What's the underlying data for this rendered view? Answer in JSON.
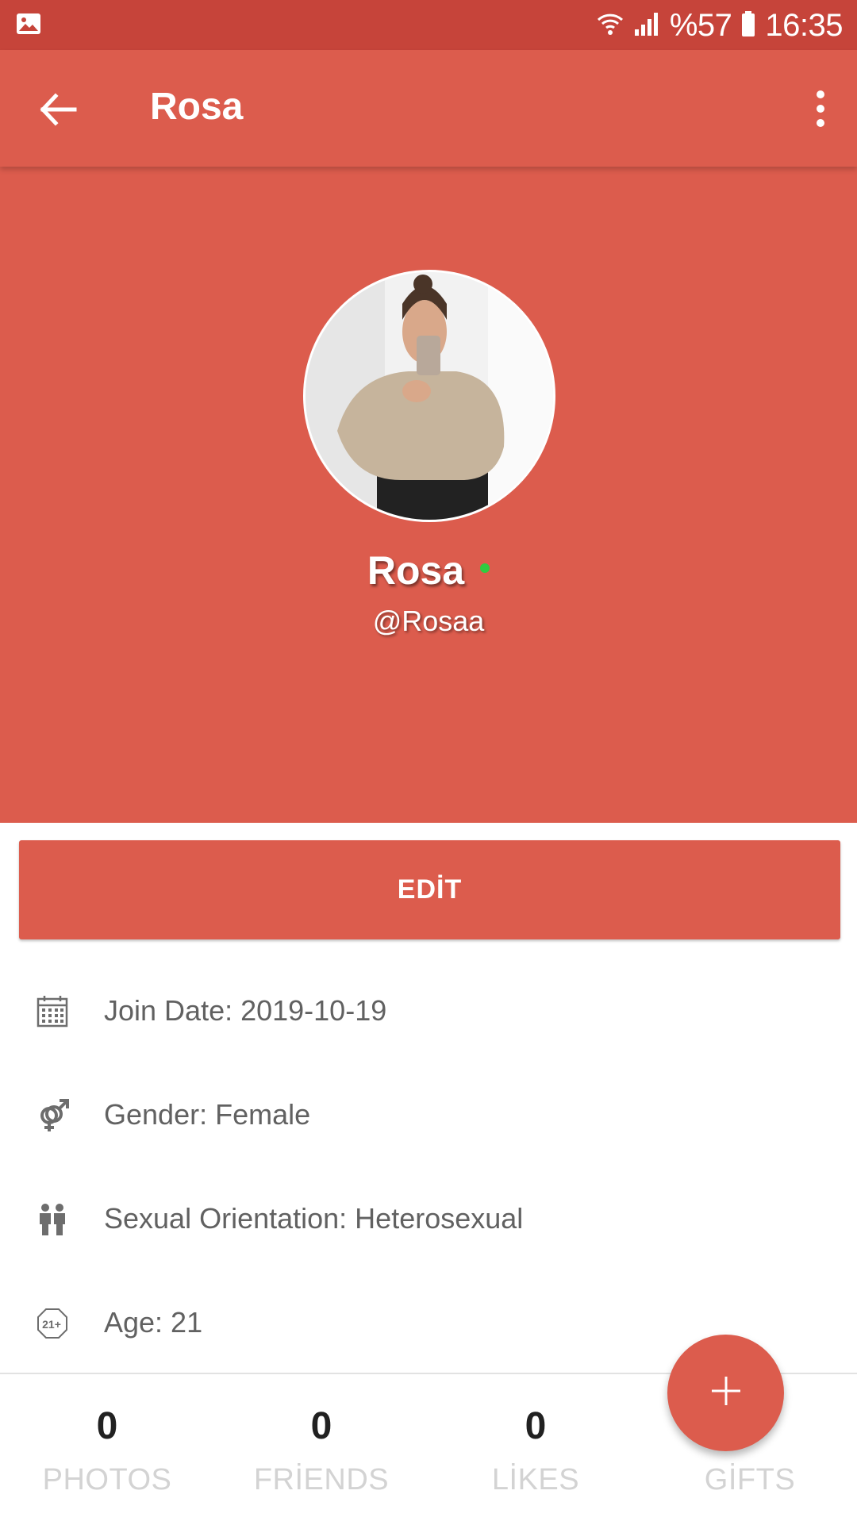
{
  "status_bar": {
    "battery": "%57",
    "time": "16:35",
    "icons": [
      "gallery-icon",
      "wifi-icon",
      "signal-icon",
      "battery-icon"
    ]
  },
  "app_bar": {
    "title": "Rosa",
    "back_icon": "arrow-back-icon",
    "menu_icon": "more-vert-icon"
  },
  "profile": {
    "name": "Rosa",
    "username": "@Rosaa",
    "online": true,
    "online_color": "#2ecc40"
  },
  "edit_button": {
    "label": "EDİT"
  },
  "info": [
    {
      "icon": "calendar-icon",
      "text": "Join Date: 2019-10-19"
    },
    {
      "icon": "gender-icon",
      "text": "Gender: Female"
    },
    {
      "icon": "people-icon",
      "text": "Sexual Orientation: Heterosexual"
    },
    {
      "icon": "age-21-icon",
      "text": "Age: 21"
    }
  ],
  "stats": [
    {
      "value": "0",
      "label": "PHOTOS"
    },
    {
      "value": "0",
      "label": "FRİENDS"
    },
    {
      "value": "0",
      "label": "LİKES"
    },
    {
      "value": "",
      "label": "GİFTS"
    }
  ],
  "fab": {
    "icon": "plus-icon"
  },
  "colors": {
    "primary": "#dc5c4d",
    "primary_dark": "#c6443a",
    "text_secondary": "#616161",
    "label_muted": "#d3d3d3"
  }
}
